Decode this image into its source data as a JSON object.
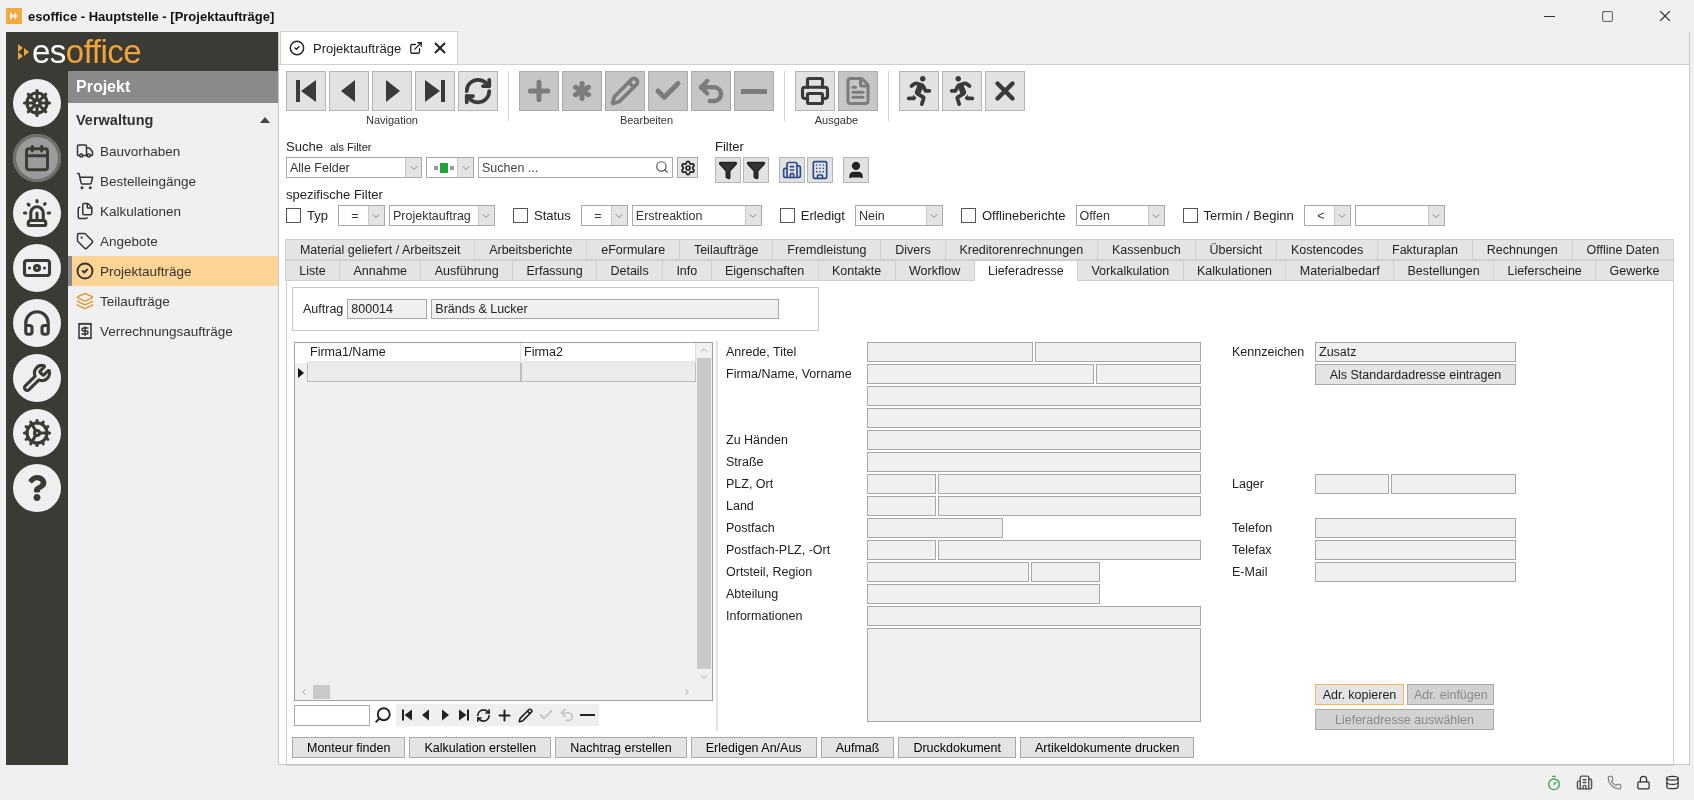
{
  "window": {
    "title": "esoffice - Hauptstelle - [Projektaufträge]"
  },
  "logo": {
    "prefix": "es",
    "suffix": "office"
  },
  "modules": [
    {
      "selected": false
    },
    {
      "selected": true
    },
    {
      "selected": false
    },
    {
      "selected": false
    },
    {
      "selected": false
    },
    {
      "selected": false
    },
    {
      "selected": false
    },
    {
      "selected": false
    }
  ],
  "nav": {
    "title": "Projekt",
    "section": {
      "label": "Verwaltung",
      "expanded": true
    },
    "items": [
      {
        "label": "Bauvorhaben",
        "selected": false
      },
      {
        "label": "Bestelleingänge",
        "selected": false
      },
      {
        "label": "Kalkulationen",
        "selected": false
      },
      {
        "label": "Angebote",
        "selected": false
      },
      {
        "label": "Projektaufträge",
        "selected": true
      },
      {
        "label": "Teilaufträge",
        "selected": false
      },
      {
        "label": "Verrechnungsaufträge",
        "selected": false
      }
    ]
  },
  "document_tab": {
    "label": "Projektaufträge"
  },
  "toolbar": {
    "groups": [
      {
        "label": "Navigation",
        "buttons": [
          {
            "disabled": false
          },
          {
            "disabled": false
          },
          {
            "disabled": false
          },
          {
            "disabled": false
          },
          {
            "disabled": false
          }
        ]
      },
      {
        "label": "Bearbeiten",
        "buttons": [
          {
            "disabled": true
          },
          {
            "disabled": true
          },
          {
            "disabled": true
          },
          {
            "disabled": true
          },
          {
            "disabled": true
          },
          {
            "disabled": true
          }
        ]
      },
      {
        "label": "Ausgabe",
        "buttons": [
          {
            "disabled": false
          },
          {
            "disabled": true
          }
        ]
      },
      {
        "buttons": [
          {
            "disabled": false
          },
          {
            "disabled": false
          },
          {
            "disabled": false
          }
        ]
      }
    ]
  },
  "search": {
    "label": "Suche",
    "hint": "als Filter",
    "field": "Alle Felder",
    "placeholder": "Suchen ..."
  },
  "filter": {
    "label": "Filter"
  },
  "specific_filter": {
    "label": "spezifische Filter",
    "items": [
      {
        "kind": "compare",
        "label": "Typ",
        "checked": false,
        "operator": "=",
        "value": "Projektauftrag"
      },
      {
        "kind": "compare",
        "label": "Status",
        "checked": false,
        "operator": "=",
        "value": "Erstreaktion"
      },
      {
        "kind": "choice",
        "label": "Erledigt",
        "checked": false,
        "value": "Nein"
      },
      {
        "kind": "choice",
        "label": "Offlineberichte",
        "checked": false,
        "value": "Offen"
      },
      {
        "kind": "compare",
        "label": "Termin / Beginn",
        "checked": false,
        "operator": "<"
      }
    ]
  },
  "tab_rows": [
    {
      "tabs": [
        {
          "label": "Material geliefert / Arbeitszeit",
          "selected": false
        },
        {
          "label": "Arbeitsberichte",
          "selected": false
        },
        {
          "label": "eFormulare",
          "selected": false
        },
        {
          "label": "Teilaufträge",
          "selected": false
        },
        {
          "label": "Fremdleistung",
          "selected": false
        },
        {
          "label": "Divers",
          "selected": false
        },
        {
          "label": "Kreditorenrechnungen",
          "selected": false
        },
        {
          "label": "Kassenbuch",
          "selected": false
        },
        {
          "label": "Übersicht",
          "selected": false
        },
        {
          "label": "Kostencodes",
          "selected": false
        },
        {
          "label": "Fakturaplan",
          "selected": false
        },
        {
          "label": "Rechnungen",
          "selected": false
        },
        {
          "label": "Offline Daten",
          "selected": false
        }
      ]
    },
    {
      "tabs": [
        {
          "label": "Liste",
          "selected": false
        },
        {
          "label": "Annahme",
          "selected": false
        },
        {
          "label": "Ausführung",
          "selected": false
        },
        {
          "label": "Erfassung",
          "selected": false
        },
        {
          "label": "Details",
          "selected": false
        },
        {
          "label": "Info",
          "selected": false
        },
        {
          "label": "Eigenschaften",
          "selected": false
        },
        {
          "label": "Kontakte",
          "selected": false
        },
        {
          "label": "Workflow",
          "selected": false
        },
        {
          "label": "Lieferadresse",
          "selected": true
        },
        {
          "label": "Vorkalkulation",
          "selected": false
        },
        {
          "label": "Kalkulationen",
          "selected": false
        },
        {
          "label": "Materialbedarf",
          "selected": false
        },
        {
          "label": "Bestellungen",
          "selected": false
        },
        {
          "label": "Lieferscheine",
          "selected": false
        },
        {
          "label": "Gewerke",
          "selected": false
        }
      ]
    }
  ],
  "order": {
    "label": "Auftrag",
    "number": "800014",
    "name": "Bränds & Lucker"
  },
  "address_list": {
    "columns": [
      "Firma1/Name",
      "Firma2"
    ]
  },
  "address_form": {
    "rows": [
      {
        "label": "Anrede, Titel",
        "kind": "halves"
      },
      {
        "label": "Firma/Name, Vorname",
        "kind": "wide-narrow"
      },
      {
        "kind": "full"
      },
      {
        "kind": "full"
      },
      {
        "label": "Zu Händen",
        "kind": "full"
      },
      {
        "label": "Straße",
        "kind": "full"
      },
      {
        "label": "PLZ, Ort",
        "kind": "narrow-wide"
      },
      {
        "label": "Land",
        "kind": "narrow-wide"
      },
      {
        "label": "Postfach",
        "kind": "short"
      },
      {
        "label": "Postfach-PLZ, -Ort",
        "kind": "narrow-wide"
      },
      {
        "label": "Ortsteil, Region",
        "kind": "region"
      },
      {
        "label": "Abteilung",
        "kind": "medium"
      },
      {
        "label": "Informationen",
        "kind": "full"
      },
      {
        "kind": "textarea"
      }
    ]
  },
  "side_form": {
    "rows": [
      {
        "kind": "field",
        "label": "Kennzeichen",
        "value": "Zusatz"
      },
      {
        "kind": "button",
        "label": "Als Standardadresse eintragen"
      },
      {
        "kind": "pair",
        "label": "Lager"
      },
      {
        "kind": "field",
        "label": "Telefon"
      },
      {
        "kind": "field",
        "label": "Telefax"
      },
      {
        "kind": "field",
        "label": "E-Mail"
      }
    ],
    "buttons": [
      {
        "label": "Adr. kopieren",
        "disabled": false,
        "focused": true
      },
      {
        "label": "Adr. einfügen",
        "disabled": true,
        "focused": false
      },
      {
        "label": "Lieferadresse auswählen",
        "disabled": true,
        "focused": false
      }
    ]
  },
  "actions": [
    "Monteur finden",
    "Kalkulation erstellen",
    "Nachtrag erstellen",
    "Erledigen An/Aus",
    "Aufmaß",
    "Druckdokument",
    "Artikeldokumente drucken"
  ]
}
